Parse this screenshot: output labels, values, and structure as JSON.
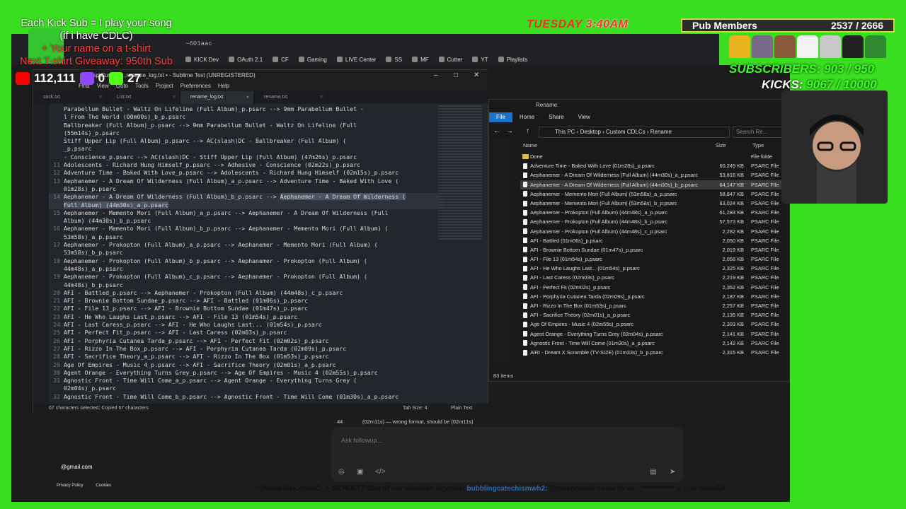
{
  "overlay": {
    "promo_line1": "Each Kick Sub = I play your song",
    "promo_line2": "(if i have CDLC)",
    "promo_line3": "+ Your name on a t-shirt",
    "promo_line4": "Next T-shirt Giveaway: 950th Sub",
    "yt_count": "112,111",
    "twitch_count": "0",
    "kick_count": "27",
    "day": "TUESDAY",
    "time": "3:40AM",
    "pub_label": "Pub Members",
    "pub_count": "2537 / 2666",
    "subs_text": "SUBSCRIBERS: 903 / 950",
    "kicks_label": "KICKS:",
    "kicks_value": "9067 / 10000",
    "ticker": "s://www.kick.com/C_J_SCHULTZ One of our absolute legends!",
    "ticker_user": "bubblingcatechismwh2:",
    "ticker_msg": "@mavomusic come to us - ************ .c.o.m sbwsEK",
    "email": "@gmail.com",
    "privacy": "Privacy Policy",
    "cookies": "Cookies"
  },
  "browser": {
    "url_fragment": "~601aac",
    "bookmarks": [
      "KICK Dev",
      "OAuth 2.1",
      "CF",
      "Gaming",
      "LIVE Center",
      "SS",
      "MF",
      "Cutter",
      "YT",
      "Playlists"
    ]
  },
  "sublime": {
    "title": "~sp\\Custom  ...rename_log.txt • - Sublime Text (UNREGISTERED)",
    "menu": [
      "Find",
      "View",
      "Goto",
      "Tools",
      "Project",
      "Preferences",
      "Help"
    ],
    "tabs": [
      {
        "label": "sock.txt"
      },
      {
        "label": "List.txt"
      },
      {
        "label": "rename_log.txt"
      },
      {
        "label": "rename.txt"
      }
    ],
    "lines": [
      {
        "n": "",
        "t": "Parabellum Bullet - Waltz On Lifeline (Full Album)_p.psarc --> 9mm Parabellum Bullet -"
      },
      {
        "n": "",
        "t": "l From The World (00m00s)_b_p.psarc"
      },
      {
        "n": "",
        "t": "Ballbreaker (Full Album)_p.psarc --> 9mm Parabellum Bullet - Waltz On Lifeline (Full"
      },
      {
        "n": "",
        "t": "(55m14s)_p.psarc"
      },
      {
        "n": "",
        "t": "Stiff Upper Lip (Full Album)_p.psarc --> AC(slash)DC - Ballbreaker (Full Album) ("
      },
      {
        "n": "",
        "t": "_p.psarc"
      },
      {
        "n": "",
        "t": "- Conscience_p.psarc --> AC(slash)DC - Stiff Upper Lip (Full Album) (47m26s)_p.psarc"
      },
      {
        "n": "11",
        "t": "Adolescents - Richard Hung Himself_p.psarc --> Adhesive - Conscience (02m22s)_p.psarc"
      },
      {
        "n": "12",
        "t": "Adventure Time - Baked With Love_p.psarc --> Adolescents - Richard Hung Himself (02m15s)_p.psarc"
      },
      {
        "n": "13",
        "t": "Aephanemer - A Dream Of Wilderness (Full Album)_a_p.psarc --> Adventure Time - Baked With Love ("
      },
      {
        "n": "",
        "t": "01m28s)_p.psarc"
      },
      {
        "n": "14",
        "t": "Aephanemer - A Dream Of Wilderness (Full Album)_b_p.psarc --> ",
        "sel": "Aephanemer - A Dream Of Wilderness (",
        "hl": true
      },
      {
        "n": "",
        "t": "",
        "sel": "Full Album) (44m30s)_a_p.psarc",
        "hl": true
      },
      {
        "n": "15",
        "t": "Aephanemer - Memento Mori (Full Album)_a_p.psarc --> Aephanemer - A Dream Of Wilderness (Full"
      },
      {
        "n": "",
        "t": "Album) (44m30s)_b_p.psarc"
      },
      {
        "n": "16",
        "t": "Aephanemer - Memento Mori (Full Album)_b_p.psarc --> Aephanemer - Memento Mori (Full Album) ("
      },
      {
        "n": "",
        "t": "53m58s)_a_p.psarc"
      },
      {
        "n": "17",
        "t": "Aephanemer - Prokopton (Full Album)_a_p.psarc --> Aephanemer - Memento Mori (Full Album) ("
      },
      {
        "n": "",
        "t": "53m58s)_b_p.psarc"
      },
      {
        "n": "18",
        "t": "Aephanemer - Prokopton (Full Album)_b_p.psarc --> Aephanemer - Prokopton (Full Album) ("
      },
      {
        "n": "",
        "t": "44m48s)_a_p.psarc"
      },
      {
        "n": "19",
        "t": "Aephanemer - Prokopton (Full Album)_c_p.psarc --> Aephanemer - Prokopton (Full Album) ("
      },
      {
        "n": "",
        "t": "44m48s)_b_p.psarc"
      },
      {
        "n": "20",
        "t": "AFI - Battled_p.psarc --> Aephanemer - Prokopton (Full Album) (44m48s)_c_p.psarc"
      },
      {
        "n": "21",
        "t": "AFI - Brownie Bottom Sundae_p.psarc --> AFI - Battled (01m06s)_p.psarc"
      },
      {
        "n": "22",
        "t": "AFI - File 13_p.psarc --> AFI - Brownie Bottom Sundae (01m47s)_p.psarc"
      },
      {
        "n": "23",
        "t": "AFI - He Who Laughs Last_p.psarc --> AFI - File 13 (01m54s)_p.psarc"
      },
      {
        "n": "24",
        "t": "AFI - Last Caress_p.psarc --> AFI - He Who Laughs Last... (01m54s)_p.psarc"
      },
      {
        "n": "25",
        "t": "AFI - Perfect Fit_p.psarc --> AFI - Last Caress (02m03s)_p.psarc"
      },
      {
        "n": "26",
        "t": "AFI - Porphyria Cutanea Tarda_p.psarc --> AFI - Perfect Fit (02m02s)_p.psarc"
      },
      {
        "n": "27",
        "t": "AFI - Rizzo In The Box_p.psarc --> AFI - Porphyria Cutanea Tarda (02m09s)_p.psarc"
      },
      {
        "n": "28",
        "t": "AFI - Sacrifice Theory_a_p.psarc --> AFI - Rizzo In The Box (01m53s)_p.psarc"
      },
      {
        "n": "29",
        "t": "Age Of Empires - Music 4_p.psarc --> AFI - Sacrifice Theory (02m01s)_a_p.psarc"
      },
      {
        "n": "30",
        "t": "Agent Orange - Everything Turns Grey_p.psarc --> Age Of Empires - Music 4 (02m55s)_p.psarc"
      },
      {
        "n": "31",
        "t": "Agnostic Front - Time Will Come_a_p.psarc --> Agent Orange - Everything Turns Grey ("
      },
      {
        "n": "",
        "t": "02m04s)_p.psarc"
      },
      {
        "n": "32",
        "t": "Agnostic Front - Time Will Come_b_p.psarc --> Agnostic Front - Time Will Come (01m30s)_a_p.psarc"
      }
    ],
    "status_left": "67 characters selected; Copied 67 characters",
    "tab_size": "Tab Size: 4",
    "syntax": "Plain Text"
  },
  "explorer": {
    "title": "Rename",
    "ribbon": [
      "File",
      "Home",
      "Share",
      "View"
    ],
    "path": [
      "This PC",
      "Desktop",
      "Custom CDLCs",
      "Rename"
    ],
    "search_placeholder": "Search Re...",
    "col_name": "Name",
    "col_size": "Size",
    "col_type": "Type",
    "files": [
      {
        "name": "Done",
        "size": "",
        "type": "File folde",
        "folder": true
      },
      {
        "name": "Adventure Time - Baked With Love (01m28s)_p.psarc",
        "size": "60,249 KB",
        "type": "PSARC File"
      },
      {
        "name": "Aephanemer - A Dream Of Wilderness (Full Album) (44m30s)_a_p.psarc",
        "size": "53,816 KB",
        "type": "PSARC File"
      },
      {
        "name": "Aephanemer - A Dream Of Wilderness (Full Album) (44m30s)_b_p.psarc",
        "size": "64,147 KB",
        "type": "PSARC File",
        "selected": true
      },
      {
        "name": "Aephanemer - Memento Mori (Full Album) (53m58s)_a_p.psarc",
        "size": "58,847 KB",
        "type": "PSARC File"
      },
      {
        "name": "Aephanemer - Memento Mori (Full Album) (53m58s)_b_p.psarc",
        "size": "63,024 KB",
        "type": "PSARC File"
      },
      {
        "name": "Aephanemer - Prokopton (Full Album) (44m48s)_a_p.psarc",
        "size": "61,283 KB",
        "type": "PSARC File"
      },
      {
        "name": "Aephanemer - Prokopton (Full Album) (44m48s)_b_p.psarc",
        "size": "57,573 KB",
        "type": "PSARC File"
      },
      {
        "name": "Aephanemer - Prokopton (Full Album) (44m48s)_c_p.psarc",
        "size": "2,282 KB",
        "type": "PSARC File"
      },
      {
        "name": "AFI - Battled (01m06s)_p.psarc",
        "size": "2,050 KB",
        "type": "PSARC File"
      },
      {
        "name": "AFI - Brownie Bottom Sundae (01m47s)_p.psarc",
        "size": "2,019 KB",
        "type": "PSARC File"
      },
      {
        "name": "AFI - File 13 (01m54s)_p.psarc",
        "size": "2,058 KB",
        "type": "PSARC File"
      },
      {
        "name": "AFI - He Who Laughs Last... (01m54s)_p.psarc",
        "size": "2,325 KB",
        "type": "PSARC File"
      },
      {
        "name": "AFI - Last Caress (02m03s)_p.psarc",
        "size": "2,219 KB",
        "type": "PSARC File"
      },
      {
        "name": "AFI - Perfect Fit (02m02s)_p.psarc",
        "size": "2,352 KB",
        "type": "PSARC File"
      },
      {
        "name": "AFI - Porphyria Cutanea Tarda (02m09s)_p.psarc",
        "size": "2,187 KB",
        "type": "PSARC File"
      },
      {
        "name": "AFI - Rizzo In The Box (01m53s)_p.psarc",
        "size": "2,257 KB",
        "type": "PSARC File"
      },
      {
        "name": "AFI - Sacrifice Theory (02m01s)_a_p.psarc",
        "size": "2,135 KB",
        "type": "PSARC File"
      },
      {
        "name": "Age Of Empires - Music 4 (02m55s)_p.psarc",
        "size": "2,303 KB",
        "type": "PSARC File"
      },
      {
        "name": "Agent Orange - Everything Turns Grey (02m04s)_p.psarc",
        "size": "2,141 KB",
        "type": "PSARC File"
      },
      {
        "name": "Agnostic Front - Time Will Come (01m30s)_a_p.psarc",
        "size": "2,142 KB",
        "type": "PSARC File"
      },
      {
        "name": "AiRI - Dream X Scramble (TV-SIZE) (01m33s)_b_p.psarc",
        "size": "2,315 KB",
        "type": "PSARC File"
      }
    ],
    "status": "83 items"
  },
  "chat": {
    "log_line_number": "44",
    "log_text": "(02m11s) — wrong format, should be (02m11s)",
    "placeholder": "Ask followup..."
  },
  "colors": {
    "green_screen": "#3ade20",
    "explorer_file_tab": "#1a73c8",
    "brand_red": "#ff2a2a",
    "sub_green": "#3cff2a"
  }
}
